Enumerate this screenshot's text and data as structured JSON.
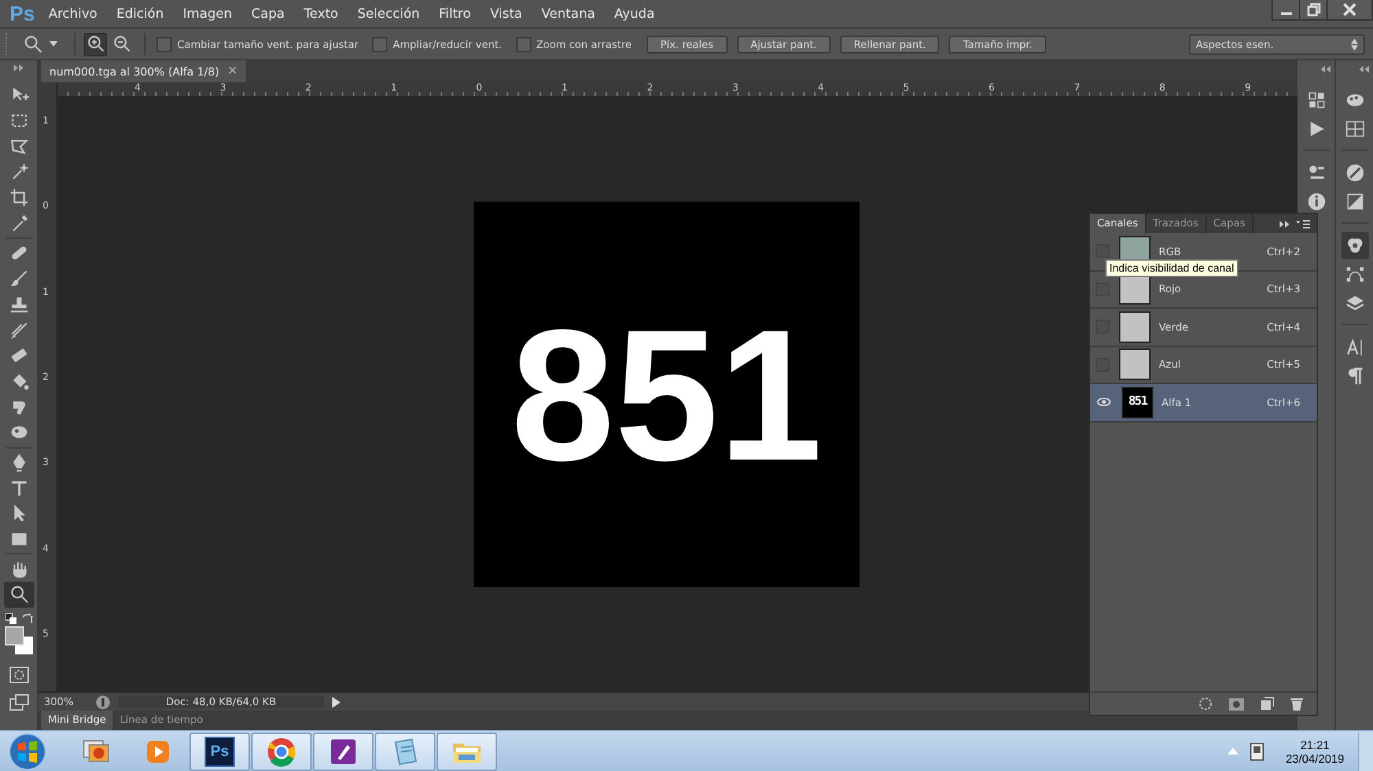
{
  "app_logo": "Ps",
  "menu": [
    "Archivo",
    "Edición",
    "Imagen",
    "Capa",
    "Texto",
    "Selección",
    "Filtro",
    "Vista",
    "Ventana",
    "Ayuda"
  ],
  "options_bar": {
    "zoom_modes": [
      {
        "kind": "zoom-in",
        "selected": true
      },
      {
        "kind": "zoom-out",
        "selected": false
      }
    ],
    "checkboxes": [
      {
        "label": "Cambiar tamaño vent. para ajustar",
        "checked": false
      },
      {
        "label": "Ampliar/reducir vent.",
        "checked": false
      },
      {
        "label": "Zoom con arrastre",
        "checked": false
      }
    ],
    "buttons": [
      "Píx. reales",
      "Ajustar pant.",
      "Rellenar pant.",
      "Tamaño impr."
    ],
    "workspace": "Aspectos esen."
  },
  "document_tab": {
    "title": "num000.tga al 300% (Alfa 1/8)",
    "close": "×"
  },
  "ruler_h": [
    "4",
    "3",
    "2",
    "1",
    "0",
    "1",
    "2",
    "3",
    "4",
    "5",
    "6",
    "7",
    "8",
    "9"
  ],
  "ruler_v": [
    "1",
    "0",
    "1",
    "2",
    "3",
    "4",
    "5"
  ],
  "canvas": {
    "text": "851"
  },
  "tools": [
    {
      "kind": "move",
      "selected": false
    },
    {
      "kind": "marquee",
      "selected": false
    },
    {
      "kind": "lasso",
      "selected": false
    },
    {
      "kind": "wand",
      "selected": false
    },
    {
      "kind": "crop",
      "selected": false
    },
    {
      "kind": "eyedropper",
      "selected": false
    },
    {
      "kind": "healing",
      "selected": false
    },
    {
      "kind": "brush",
      "selected": false
    },
    {
      "kind": "stamp",
      "selected": false
    },
    {
      "kind": "history",
      "selected": false
    },
    {
      "kind": "eraser",
      "selected": false
    },
    {
      "kind": "bucket",
      "selected": false
    },
    {
      "kind": "smudge",
      "selected": false
    },
    {
      "kind": "dodge",
      "selected": false
    },
    {
      "kind": "pen",
      "selected": false
    },
    {
      "kind": "type",
      "selected": false
    },
    {
      "kind": "path",
      "selected": false
    },
    {
      "kind": "shape",
      "selected": false
    },
    {
      "kind": "hand",
      "selected": false
    },
    {
      "kind": "zoom",
      "selected": true
    }
  ],
  "status_bar": {
    "zoom": "300%",
    "doc": "Doc: 48,0 KB/64,0 KB"
  },
  "bottom_tabs": [
    {
      "label": "Mini Bridge",
      "selected": true
    },
    {
      "label": "Línea de tiempo",
      "selected": false
    }
  ],
  "channels_panel": {
    "tabs": [
      {
        "label": "Canales",
        "selected": true
      },
      {
        "label": "Trazados",
        "selected": false
      },
      {
        "label": "Capas",
        "selected": false
      }
    ],
    "channels": [
      {
        "name": "RGB",
        "shortcut": "Ctrl+2",
        "visible": false,
        "selected": false,
        "color": "#8fa49e"
      },
      {
        "name": "Rojo",
        "shortcut": "Ctrl+3",
        "visible": false,
        "selected": false,
        "color": "#c2c2c2"
      },
      {
        "name": "Verde",
        "shortcut": "Ctrl+4",
        "visible": false,
        "selected": false,
        "color": "#c2c2c2"
      },
      {
        "name": "Azul",
        "shortcut": "Ctrl+5",
        "visible": false,
        "selected": false,
        "color": "#c2c2c2"
      },
      {
        "name": "Alfa 1",
        "shortcut": "Ctrl+6",
        "visible": true,
        "selected": true,
        "color": "#000000",
        "thumb_text": "851"
      }
    ],
    "tooltip": "Indica visibilidad de canal"
  },
  "taskbar": {
    "apps": [
      {
        "kind": "images",
        "running": false
      },
      {
        "kind": "media",
        "running": false
      },
      {
        "kind": "ps",
        "running": true,
        "label": "Ps"
      },
      {
        "kind": "browser",
        "running": true
      },
      {
        "kind": "pen",
        "running": true
      },
      {
        "kind": "notepad",
        "running": true
      },
      {
        "kind": "folder",
        "running": true
      }
    ],
    "time": "21:21",
    "date": "23/04/2019"
  }
}
